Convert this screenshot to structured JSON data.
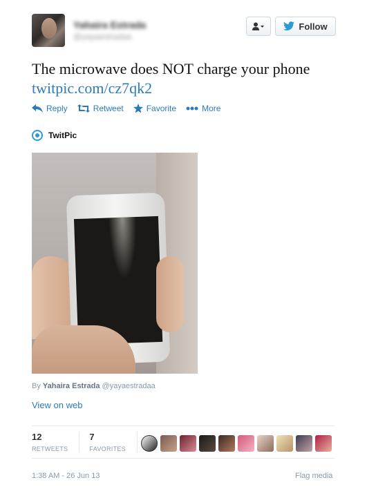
{
  "header": {
    "display_name": "Yahaira Estrada",
    "handle": "@yayaestradaa",
    "follow_label": "Follow"
  },
  "tweet": {
    "text": "The microwave does NOT charge your phone",
    "link": "twitpic.com/cz7qk2"
  },
  "actions": {
    "reply": "Reply",
    "retweet": "Retweet",
    "favorite": "Favorite",
    "more": "More"
  },
  "card": {
    "source": "TwitPic",
    "byline_prefix": "By",
    "byline_name": "Yahaira Estrada",
    "byline_handle": "@yayaestradaa",
    "view_on_web": "View on web"
  },
  "stats": {
    "retweets_count": "12",
    "retweets_label": "RETWEETS",
    "favorites_count": "7",
    "favorites_label": "FAVORITES"
  },
  "favoriters": [
    {
      "color_a": "#ffffff",
      "color_b": "#222222"
    },
    {
      "color_a": "#7a5c52",
      "color_b": "#c9a08c"
    },
    {
      "color_a": "#6b2430",
      "color_b": "#d98a97"
    },
    {
      "color_a": "#1c1a19",
      "color_b": "#5a4a40"
    },
    {
      "color_a": "#3c2a24",
      "color_b": "#b07a60"
    },
    {
      "color_a": "#d45a7a",
      "color_b": "#f3b3c4"
    },
    {
      "color_a": "#e6d4c8",
      "color_b": "#8d6b5c"
    },
    {
      "color_a": "#f0e2b8",
      "color_b": "#b8926a"
    },
    {
      "color_a": "#3e3a4e",
      "color_b": "#c1a4a8"
    },
    {
      "color_a": "#b01e44",
      "color_b": "#e8b0a0"
    }
  ],
  "footer": {
    "timestamp": "1:38 AM - 26 Jun 13",
    "flag": "Flag media"
  },
  "colors": {
    "link": "#2b7bb9",
    "meta": "#8899a6"
  }
}
